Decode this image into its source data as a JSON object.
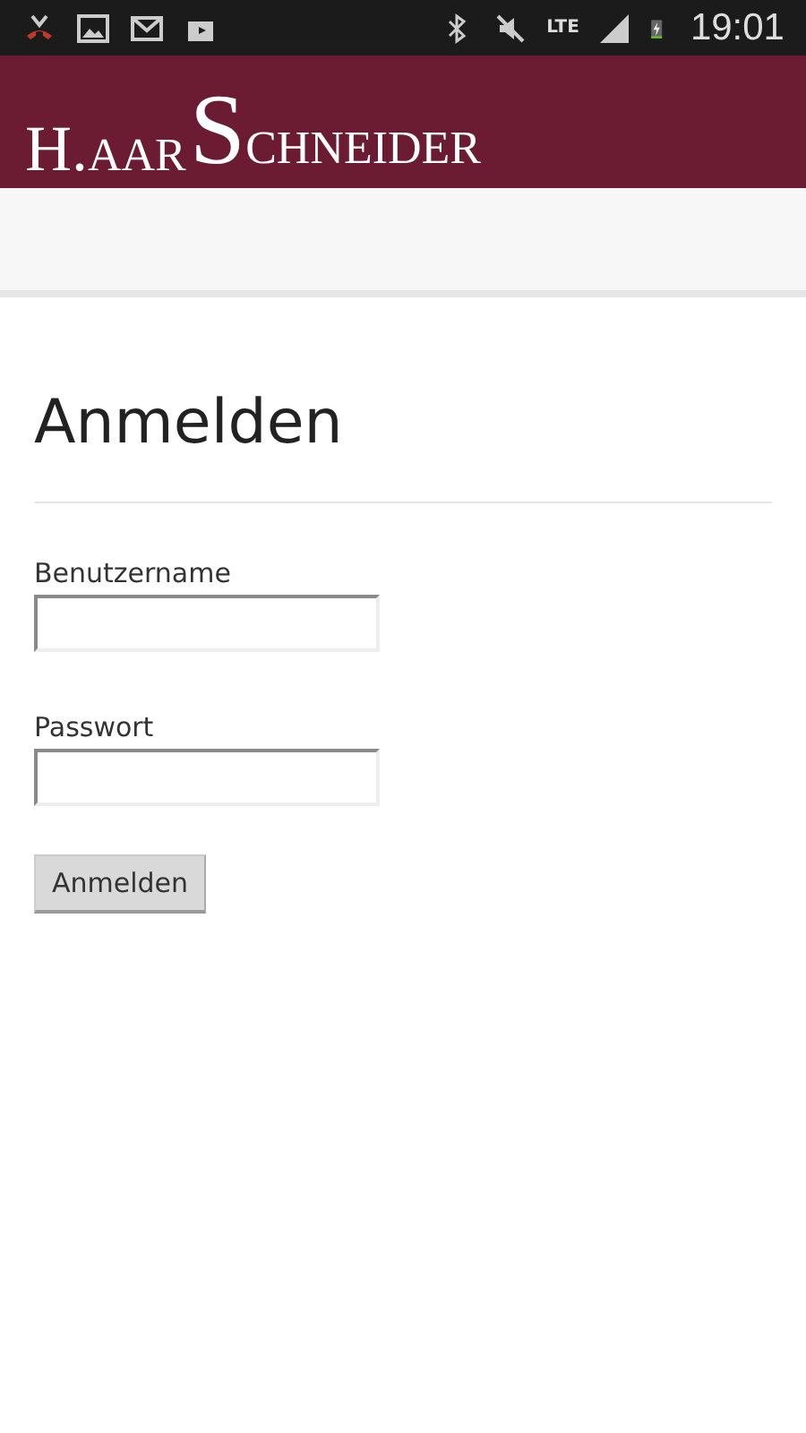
{
  "status_bar": {
    "network": "LTE",
    "time": "19:01"
  },
  "header": {
    "logo_words": [
      "H.AAR",
      "SCHNEIDER"
    ]
  },
  "page": {
    "title": "Anmelden",
    "fields": [
      {
        "label": "Benutzername"
      },
      {
        "label": "Passwort"
      }
    ],
    "submit": "Anmelden"
  }
}
